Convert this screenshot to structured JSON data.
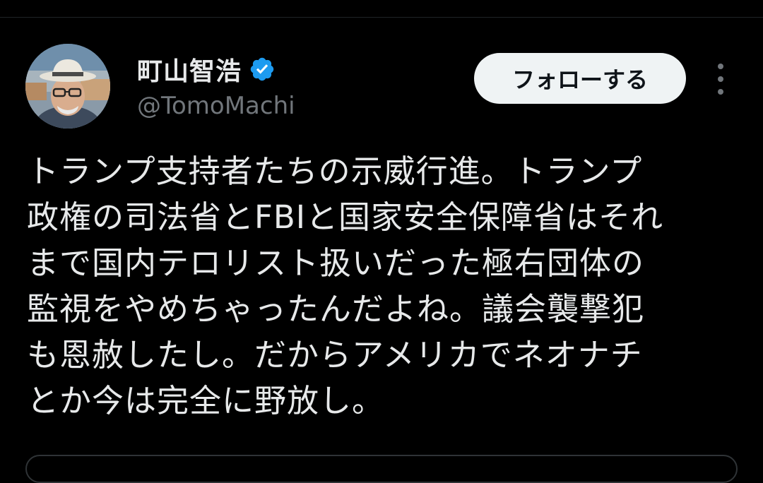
{
  "author": {
    "display_name": "町山智浩",
    "handle": "@TomoMachi",
    "verified_icon": "verified-badge-icon",
    "avatar": "avatar-photo"
  },
  "actions": {
    "follow_label": "フォローする",
    "more_icon": "more-vertical-icon"
  },
  "tweet": {
    "lines": [
      "トランプ支持者たちの示威行進。トランプ",
      "政権の司法省とFBIと国家安全保障省はそれ",
      "まで国内テロリスト扱いだった極右団体の",
      "監視をやめちゃったんだよね。議会襲撃犯",
      "も恩赦したし。だからアメリカでネオナチ",
      "とか今は完全に野放し。"
    ]
  },
  "colors": {
    "background": "#000000",
    "text_primary": "#e7e9ea",
    "text_secondary": "#71767b",
    "verified_blue": "#1d9bf0",
    "follow_bg": "#eff3f4",
    "follow_text": "#0f1419"
  }
}
